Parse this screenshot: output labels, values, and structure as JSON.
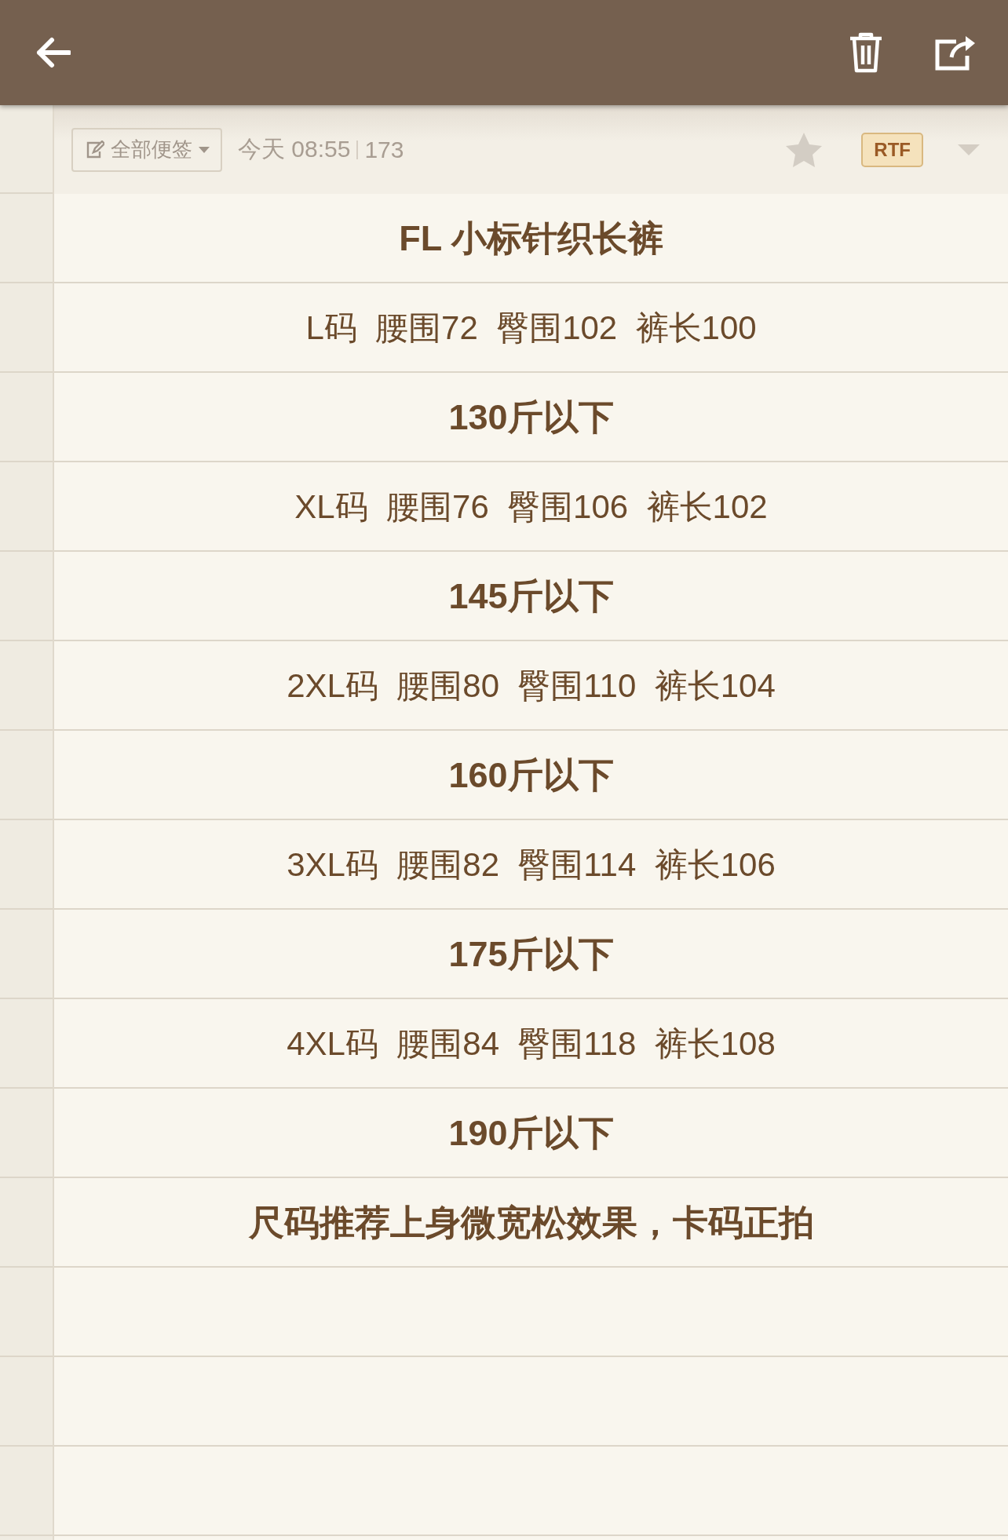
{
  "meta": {
    "folder": "全部便签",
    "date": "今天 08:55",
    "count": "173",
    "starred": false,
    "format": "RTF"
  },
  "lines": [
    {
      "kind": "bold",
      "text": "FL 小标针织长裤"
    },
    {
      "kind": "plain",
      "text": "L码  腰围72  臀围102  裤长100"
    },
    {
      "kind": "bold",
      "text": "130斤以下"
    },
    {
      "kind": "plain",
      "text": "XL码  腰围76  臀围106  裤长102"
    },
    {
      "kind": "bold",
      "text": "145斤以下"
    },
    {
      "kind": "plain",
      "text": "2XL码  腰围80  臀围110  裤长104"
    },
    {
      "kind": "bold",
      "text": "160斤以下"
    },
    {
      "kind": "plain",
      "text": "3XL码  腰围82  臀围114  裤长106"
    },
    {
      "kind": "bold",
      "text": "175斤以下"
    },
    {
      "kind": "plain",
      "text": "4XL码  腰围84  臀围118  裤长108"
    },
    {
      "kind": "bold",
      "text": "190斤以下"
    },
    {
      "kind": "bold",
      "text": "尺码推荐上身微宽松效果，卡码正拍"
    }
  ]
}
